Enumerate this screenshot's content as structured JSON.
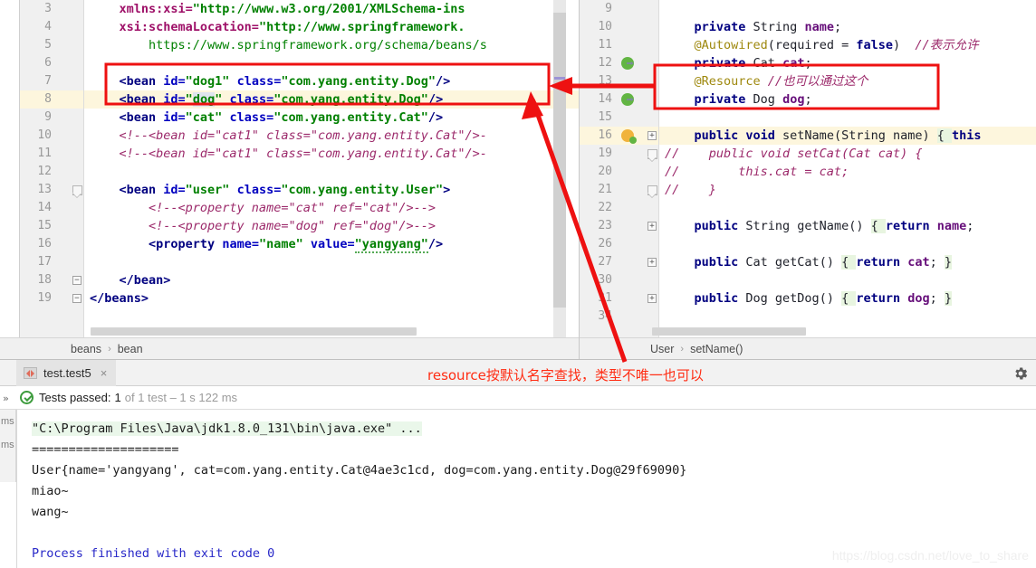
{
  "left_editor": {
    "name": "spring-beans-xml-editor",
    "first_visible_line": 3,
    "lines": [
      {
        "num": 3,
        "indent": 0,
        "partial": true,
        "segments": [
          {
            "t": "ns",
            "v": "    xmlns:xsi="
          },
          {
            "t": "val",
            "v": "\"http://www.w3.org/2001/XMLSchema-ins"
          }
        ]
      },
      {
        "num": 4,
        "indent": 0,
        "segments": [
          {
            "t": "ns",
            "v": "    xsi:schemaLocation="
          },
          {
            "t": "val",
            "v": "\"http://www.springframework."
          }
        ]
      },
      {
        "num": 5,
        "indent": 0,
        "segments": [
          {
            "t": "url",
            "v": "        https://www.springframework.org/schema/beans/s"
          }
        ]
      },
      {
        "num": 6,
        "indent": 0,
        "segments": []
      },
      {
        "num": 7,
        "indent": 0,
        "boxed": true,
        "segments": [
          {
            "t": "tag",
            "v": "    <bean "
          },
          {
            "t": "attr",
            "v": "id="
          },
          {
            "t": "val",
            "v": "\"dog1\" "
          },
          {
            "t": "attr",
            "v": "class="
          },
          {
            "t": "val",
            "v": "\"com.yang.entity.Dog\""
          },
          {
            "t": "tag",
            "v": "/>"
          }
        ]
      },
      {
        "num": 8,
        "indent": 0,
        "highlight": true,
        "boxed": true,
        "segments": [
          {
            "t": "tag",
            "v": "    <bean "
          },
          {
            "t": "attr",
            "v": "id="
          },
          {
            "t": "val",
            "v": "\""
          },
          {
            "t": "sel",
            "v": "dog"
          },
          {
            "t": "val",
            "v": "\" "
          },
          {
            "t": "attr",
            "v": "class="
          },
          {
            "t": "val",
            "v": "\"com.yang.entity.Dog\""
          },
          {
            "t": "tag",
            "v": "/>"
          }
        ]
      },
      {
        "num": 9,
        "indent": 0,
        "segments": [
          {
            "t": "tag",
            "v": "    <bean "
          },
          {
            "t": "attr",
            "v": "id="
          },
          {
            "t": "val",
            "v": "\"cat\" "
          },
          {
            "t": "attr",
            "v": "class="
          },
          {
            "t": "val",
            "v": "\"com.yang.entity.Cat\""
          },
          {
            "t": "tag",
            "v": "/>"
          }
        ]
      },
      {
        "num": 10,
        "indent": 0,
        "segments": [
          {
            "t": "cmt",
            "v": "    <!--<bean id=\"cat1\" class=\"com.yang.entity.Cat\"/>-"
          }
        ]
      },
      {
        "num": 11,
        "indent": 0,
        "segments": [
          {
            "t": "cmt",
            "v": "    <!--<bean id=\"cat1\" class=\"com.yang.entity.Cat\"/>-"
          }
        ]
      },
      {
        "num": 12,
        "indent": 0,
        "segments": []
      },
      {
        "num": 13,
        "indent": 0,
        "fold": "minus-round",
        "segments": [
          {
            "t": "tag",
            "v": "    <bean "
          },
          {
            "t": "attr",
            "v": "id="
          },
          {
            "t": "val",
            "v": "\"user\" "
          },
          {
            "t": "attr",
            "v": "class="
          },
          {
            "t": "val",
            "v": "\"com.yang.entity.User\""
          },
          {
            "t": "tag",
            "v": ">"
          }
        ]
      },
      {
        "num": 14,
        "indent": 0,
        "segments": [
          {
            "t": "cmt",
            "v": "        <!--<property name=\"cat\" ref=\"cat\"/>-->"
          }
        ]
      },
      {
        "num": 15,
        "indent": 0,
        "segments": [
          {
            "t": "cmt",
            "v": "        <!--<property name=\"dog\" ref=\"dog\"/>-->"
          }
        ]
      },
      {
        "num": 16,
        "indent": 0,
        "segments": [
          {
            "t": "tag",
            "v": "        <property "
          },
          {
            "t": "attr",
            "v": "name="
          },
          {
            "t": "val",
            "v": "\"name\" "
          },
          {
            "t": "attr",
            "v": "value="
          },
          {
            "t": "val-squig",
            "v": "\"yangyang\""
          },
          {
            "t": "tag",
            "v": "/>"
          }
        ]
      },
      {
        "num": 17,
        "indent": 0,
        "segments": []
      },
      {
        "num": 18,
        "indent": 0,
        "fold": "minus",
        "segments": [
          {
            "t": "tag",
            "v": "    </bean>"
          }
        ]
      },
      {
        "num": 19,
        "indent": 0,
        "fold": "minus",
        "segments": [
          {
            "t": "tag",
            "v": "</beans>"
          }
        ]
      }
    ],
    "breadcrumb": [
      "beans",
      "bean"
    ]
  },
  "right_editor": {
    "name": "user-java-editor",
    "lines": [
      {
        "num": 9,
        "partial": true,
        "segments": []
      },
      {
        "num": 10,
        "segments": [
          {
            "t": "kw",
            "v": "    private "
          },
          {
            "t": "type",
            "v": "String "
          },
          {
            "t": "fld",
            "v": "name"
          },
          {
            "t": "plain",
            "v": ";"
          }
        ]
      },
      {
        "num": 11,
        "segments": [
          {
            "t": "ann",
            "v": "    @Autowired"
          },
          {
            "t": "plain",
            "v": "(required = "
          },
          {
            "t": "kw",
            "v": "false"
          },
          {
            "t": "plain",
            "v": ")  "
          },
          {
            "t": "cmt",
            "v": "//表示允许"
          }
        ]
      },
      {
        "num": 12,
        "gutter_icon": "bean-marker",
        "segments": [
          {
            "t": "kw",
            "v": "    private "
          },
          {
            "t": "type",
            "v": "Cat "
          },
          {
            "t": "fld",
            "v": "cat"
          },
          {
            "t": "plain",
            "v": ";"
          }
        ]
      },
      {
        "num": 13,
        "boxed": true,
        "segments": [
          {
            "t": "ann",
            "v": "    @Resource "
          },
          {
            "t": "cmt",
            "v": "//也可以通过这个"
          }
        ]
      },
      {
        "num": 14,
        "gutter_icon": "bean-marker",
        "boxed": true,
        "segments": [
          {
            "t": "kw",
            "v": "    private "
          },
          {
            "t": "type",
            "v": "Dog "
          },
          {
            "t": "fld",
            "v": "dog"
          },
          {
            "t": "plain",
            "v": ";"
          }
        ]
      },
      {
        "num": 15,
        "segments": []
      },
      {
        "num": 16,
        "highlight": true,
        "gutter_icon": "run-marker",
        "fold": "plus",
        "segments": [
          {
            "t": "kw",
            "v": "    public void "
          },
          {
            "t": "type",
            "v": "setName"
          },
          {
            "t": "plain",
            "v": "(String name) "
          },
          {
            "t": "brace",
            "v": "{ "
          },
          {
            "t": "kw",
            "v": "this"
          }
        ]
      },
      {
        "num": 19,
        "fold": "minus-round",
        "segments": [
          {
            "t": "cmt",
            "v": "//    public void setCat(Cat cat) {"
          }
        ]
      },
      {
        "num": 20,
        "segments": [
          {
            "t": "cmt",
            "v": "//        this.cat = cat;"
          }
        ]
      },
      {
        "num": 21,
        "fold": "minus-round",
        "segments": [
          {
            "t": "cmt",
            "v": "//    }"
          }
        ]
      },
      {
        "num": 22,
        "segments": []
      },
      {
        "num": 23,
        "fold": "plus",
        "segments": [
          {
            "t": "kw",
            "v": "    public "
          },
          {
            "t": "type",
            "v": "String getName"
          },
          {
            "t": "plain",
            "v": "() "
          },
          {
            "t": "brace",
            "v": "{ "
          },
          {
            "t": "kw",
            "v": "return "
          },
          {
            "t": "fld",
            "v": "name"
          },
          {
            "t": "plain",
            "v": ";"
          }
        ]
      },
      {
        "num": 26,
        "segments": []
      },
      {
        "num": 27,
        "fold": "plus",
        "segments": [
          {
            "t": "kw",
            "v": "    public "
          },
          {
            "t": "type",
            "v": "Cat getCat"
          },
          {
            "t": "plain",
            "v": "() "
          },
          {
            "t": "brace",
            "v": "{ "
          },
          {
            "t": "kw",
            "v": "return "
          },
          {
            "t": "fld",
            "v": "cat"
          },
          {
            "t": "plain",
            "v": "; "
          },
          {
            "t": "brace",
            "v": "}"
          }
        ]
      },
      {
        "num": 30,
        "segments": []
      },
      {
        "num": 31,
        "fold": "plus",
        "segments": [
          {
            "t": "kw",
            "v": "    public "
          },
          {
            "t": "type",
            "v": "Dog getDog"
          },
          {
            "t": "plain",
            "v": "() "
          },
          {
            "t": "brace",
            "v": "{ "
          },
          {
            "t": "kw",
            "v": "return "
          },
          {
            "t": "fld",
            "v": "dog"
          },
          {
            "t": "plain",
            "v": "; "
          },
          {
            "t": "brace",
            "v": "}"
          }
        ]
      },
      {
        "num": 34,
        "partial": true,
        "segments": []
      }
    ],
    "breadcrumb": [
      "User",
      "setName()"
    ]
  },
  "run_panel": {
    "tab": {
      "label": "test.test5",
      "close": "×",
      "icon": "run-config-icon"
    },
    "gear_icon": "settings-gear-icon",
    "status": {
      "icon": "tests-passed-icon",
      "label": "Tests passed:",
      "count": "1",
      "detail": "of 1 test – 1 s 122 ms"
    },
    "tree_ms_labels": [
      "ms",
      "ms"
    ],
    "expand_icon": "»",
    "console_lines": [
      {
        "text": "\"C:\\Program Files\\Java\\jdk1.8.0_131\\bin\\java.exe\" ...",
        "style": "cmd"
      },
      {
        "text": "====================",
        "style": "plain"
      },
      {
        "text": "User{name='yangyang', cat=com.yang.entity.Cat@4ae3c1cd, dog=com.yang.entity.Dog@29f69090}",
        "style": "plain"
      },
      {
        "text": "miao~",
        "style": "plain"
      },
      {
        "text": "wang~",
        "style": "plain"
      },
      {
        "text": "",
        "style": "plain"
      },
      {
        "text": "Process finished with exit code 0",
        "style": "exit"
      }
    ]
  },
  "annotations": {
    "red_note": "resource按默认名字查找，类型不唯一也可以",
    "red_color": "#ff2d14",
    "box_left_label": "xml-bean-dog-highlight-box",
    "box_right_label": "resource-annotation-highlight-box",
    "arrow_horizontal_label": "arrow-xml-to-resource",
    "arrow_diagonal_label": "arrow-note-to-xml"
  },
  "watermark": {
    "text": "https://blog.csdn.net/love_to_share"
  }
}
